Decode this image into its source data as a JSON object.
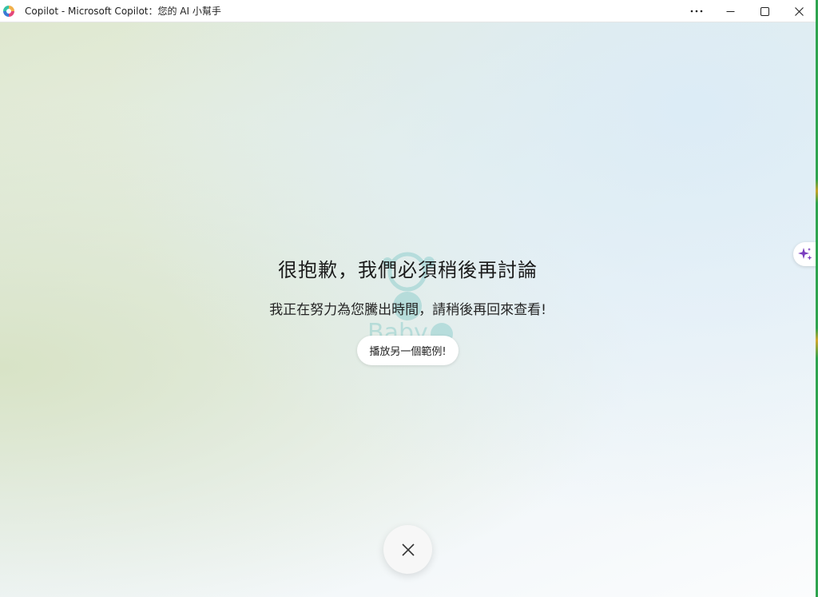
{
  "window": {
    "title": "Copilot - Microsoft Copilot：您的 AI 小幫手",
    "icon": "copilot-logo-icon",
    "controls": {
      "more": "more-options-icon",
      "minimize": "minimize-icon",
      "maximize": "maximize-icon",
      "close": "close-icon"
    }
  },
  "main": {
    "headline": "很抱歉，我們必須稍後再討論",
    "message": "我正在努力為您騰出時間，請稍後再回來查看!",
    "example_button_label": "播放另一個範例!",
    "watermark_text": "Baby",
    "side_button_icon": "sparkle-icon",
    "close_button_icon": "close-icon"
  },
  "colors": {
    "sparkle": "#7b3fbf",
    "text": "#1b1b1b"
  }
}
